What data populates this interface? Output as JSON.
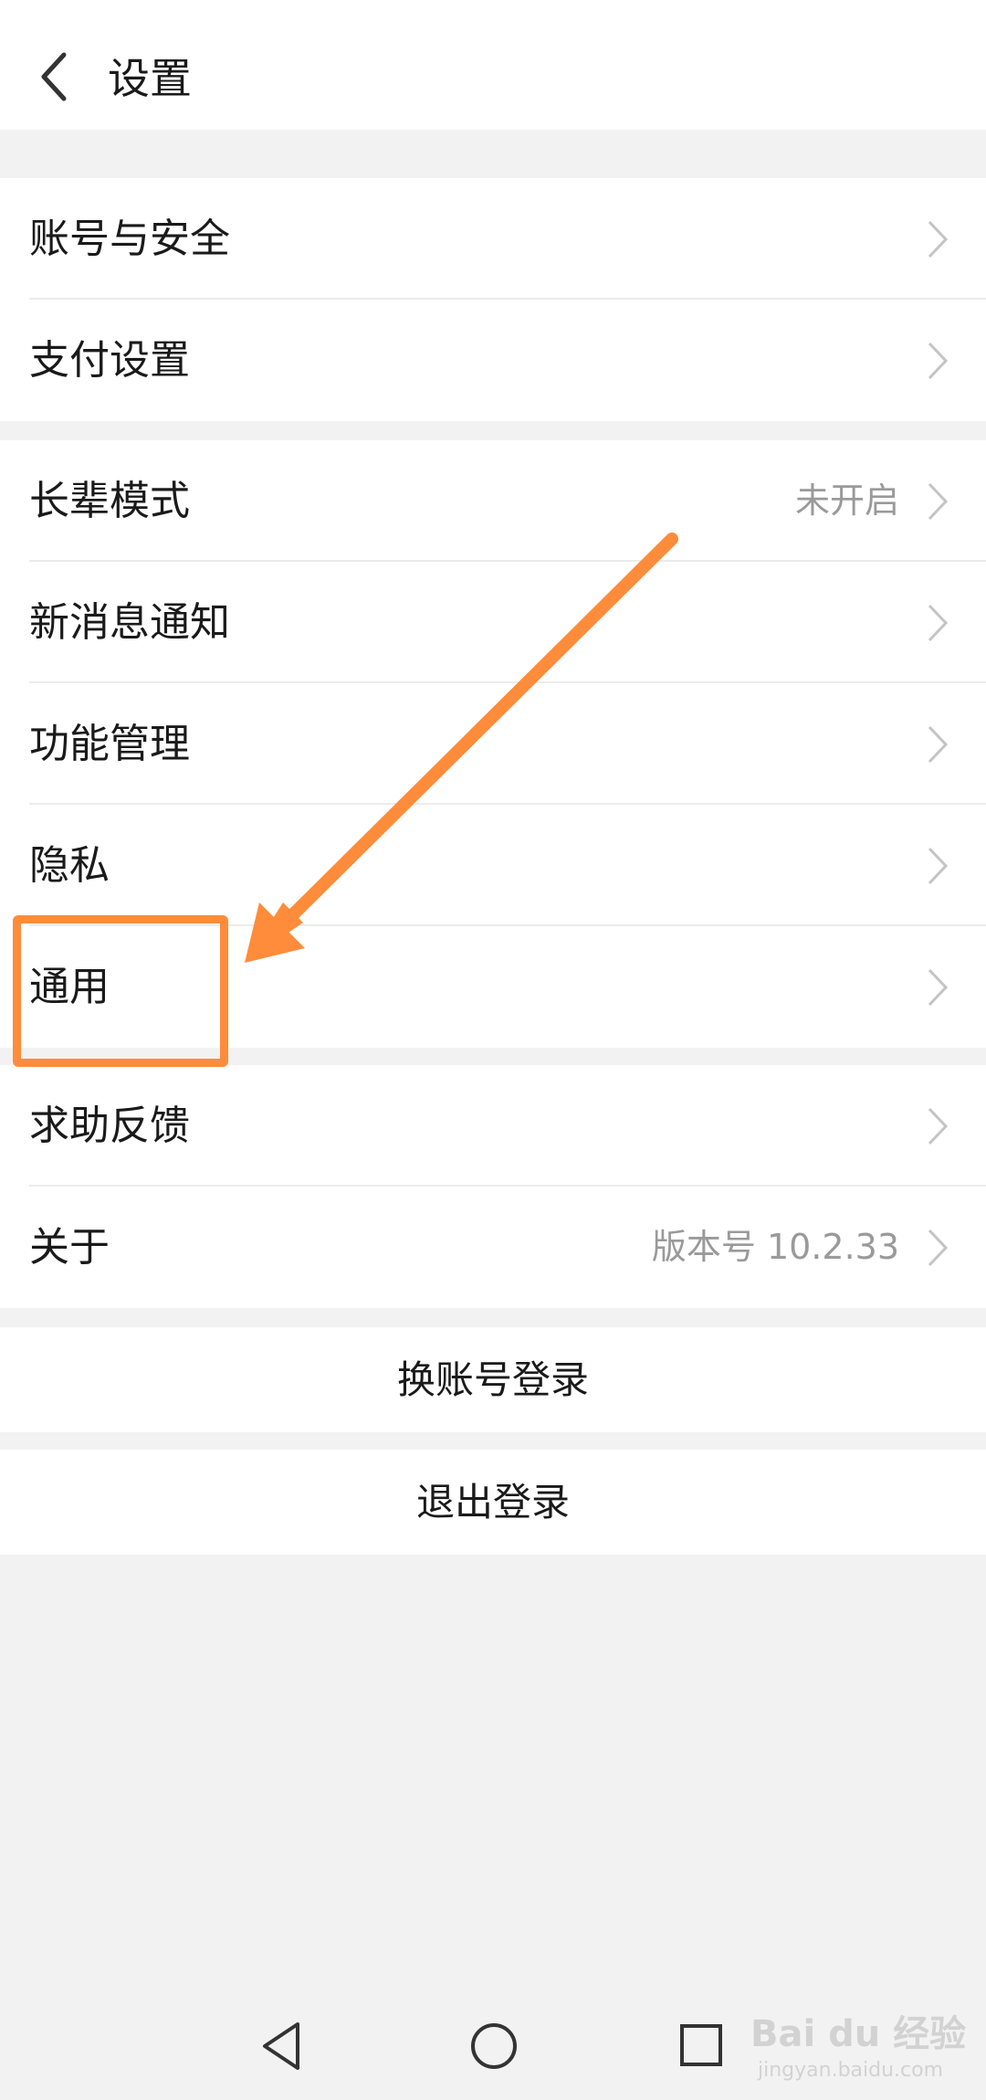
{
  "header": {
    "title": "设置"
  },
  "groups": [
    {
      "rows": [
        {
          "label": "账号与安全",
          "value": ""
        },
        {
          "label": "支付设置",
          "value": ""
        }
      ]
    },
    {
      "rows": [
        {
          "label": "长辈模式",
          "value": "未开启"
        },
        {
          "label": "新消息通知",
          "value": ""
        },
        {
          "label": "功能管理",
          "value": ""
        },
        {
          "label": "隐私",
          "value": ""
        },
        {
          "label": "通用",
          "value": ""
        }
      ]
    },
    {
      "rows": [
        {
          "label": "求助反馈",
          "value": ""
        },
        {
          "label": "关于",
          "value": "版本号 10.2.33"
        }
      ]
    }
  ],
  "actions": {
    "switch_account": "换账号登录",
    "logout": "退出登录"
  },
  "watermark": {
    "brand": "Bai du 经验",
    "url": "jingyan.baidu.com"
  },
  "icons": {
    "back": "chevron-left-icon",
    "row_arrow": "chevron-right-icon",
    "nav_back": "triangle-back-icon",
    "nav_home": "circle-home-icon",
    "nav_recents": "square-recents-icon"
  },
  "colors": {
    "annotation": "#ff8c3a",
    "background": "#f2f2f2",
    "secondary_text": "#9a9a9a"
  }
}
